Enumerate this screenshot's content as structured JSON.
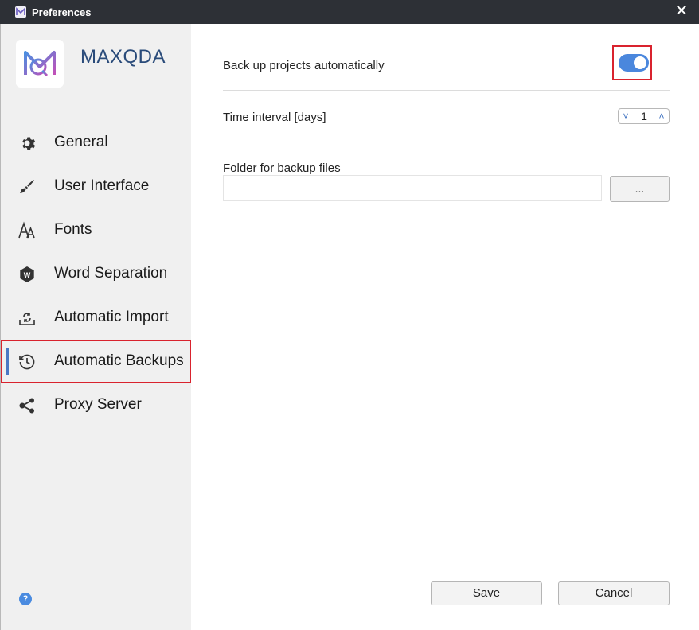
{
  "window": {
    "title": "Preferences",
    "close_icon": "close-icon"
  },
  "sidebar": {
    "brand": "MAXQDA",
    "items": [
      {
        "label": "General",
        "icon": "gear-icon"
      },
      {
        "label": "User Interface",
        "icon": "paintbrush-icon"
      },
      {
        "label": "Fonts",
        "icon": "font-icon"
      },
      {
        "label": "Word Separation",
        "icon": "word-separation-icon"
      },
      {
        "label": "Automatic Import",
        "icon": "import-icon"
      },
      {
        "label": "Automatic Backups",
        "icon": "history-icon",
        "active": true
      },
      {
        "label": "Proxy Server",
        "icon": "share-icon"
      }
    ],
    "help_icon": "help-icon",
    "help_glyph": "?"
  },
  "main": {
    "backup_label": "Back up projects automatically",
    "backup_enabled": true,
    "interval_label": "Time interval [days]",
    "interval_value": "1",
    "spinner_down": "˅",
    "spinner_up": "˄",
    "folder_label": "Folder for backup files",
    "folder_value": "",
    "browse_label": "..."
  },
  "footer": {
    "save_label": "Save",
    "cancel_label": "Cancel"
  },
  "colors": {
    "accent": "#4a87dd",
    "highlight": "#d9232e",
    "titlebar": "#2d3036",
    "sidebar": "#f0f0f0"
  }
}
